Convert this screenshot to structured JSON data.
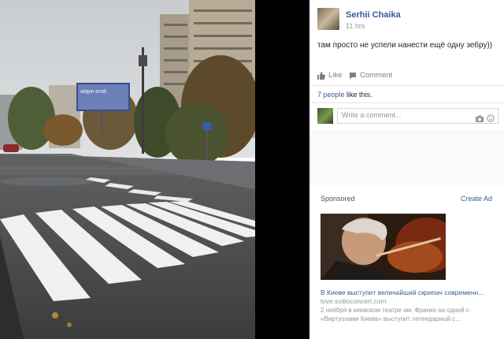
{
  "post": {
    "author": "Serhii Chaika",
    "time": "11 hrs",
    "text": "там просто не успели нанести ещё одну зебру))",
    "billboard_text": "АЙДИН ФЛЭЙ"
  },
  "actions": {
    "like": "Like",
    "comment": "Comment"
  },
  "likes": {
    "count_link": "7 people",
    "suffix": " like this."
  },
  "comment_input": {
    "placeholder": "Write a comment..."
  },
  "sponsored": {
    "label": "Sponsored",
    "create_ad": "Create Ad",
    "ad": {
      "title": "В Киеве выступит величайший скрипач современн...",
      "url": "love.svitloconcert.com",
      "description_line1": "2 ноября в киевском театре им. Франко на одной с",
      "description_line2": "«Виртуозами Киева» выступит легендарный с..."
    }
  },
  "colors": {
    "link": "#3b5998",
    "muted": "#90949c"
  },
  "icons": [
    "like-icon",
    "comment-icon",
    "camera-icon",
    "smiley-icon"
  ]
}
